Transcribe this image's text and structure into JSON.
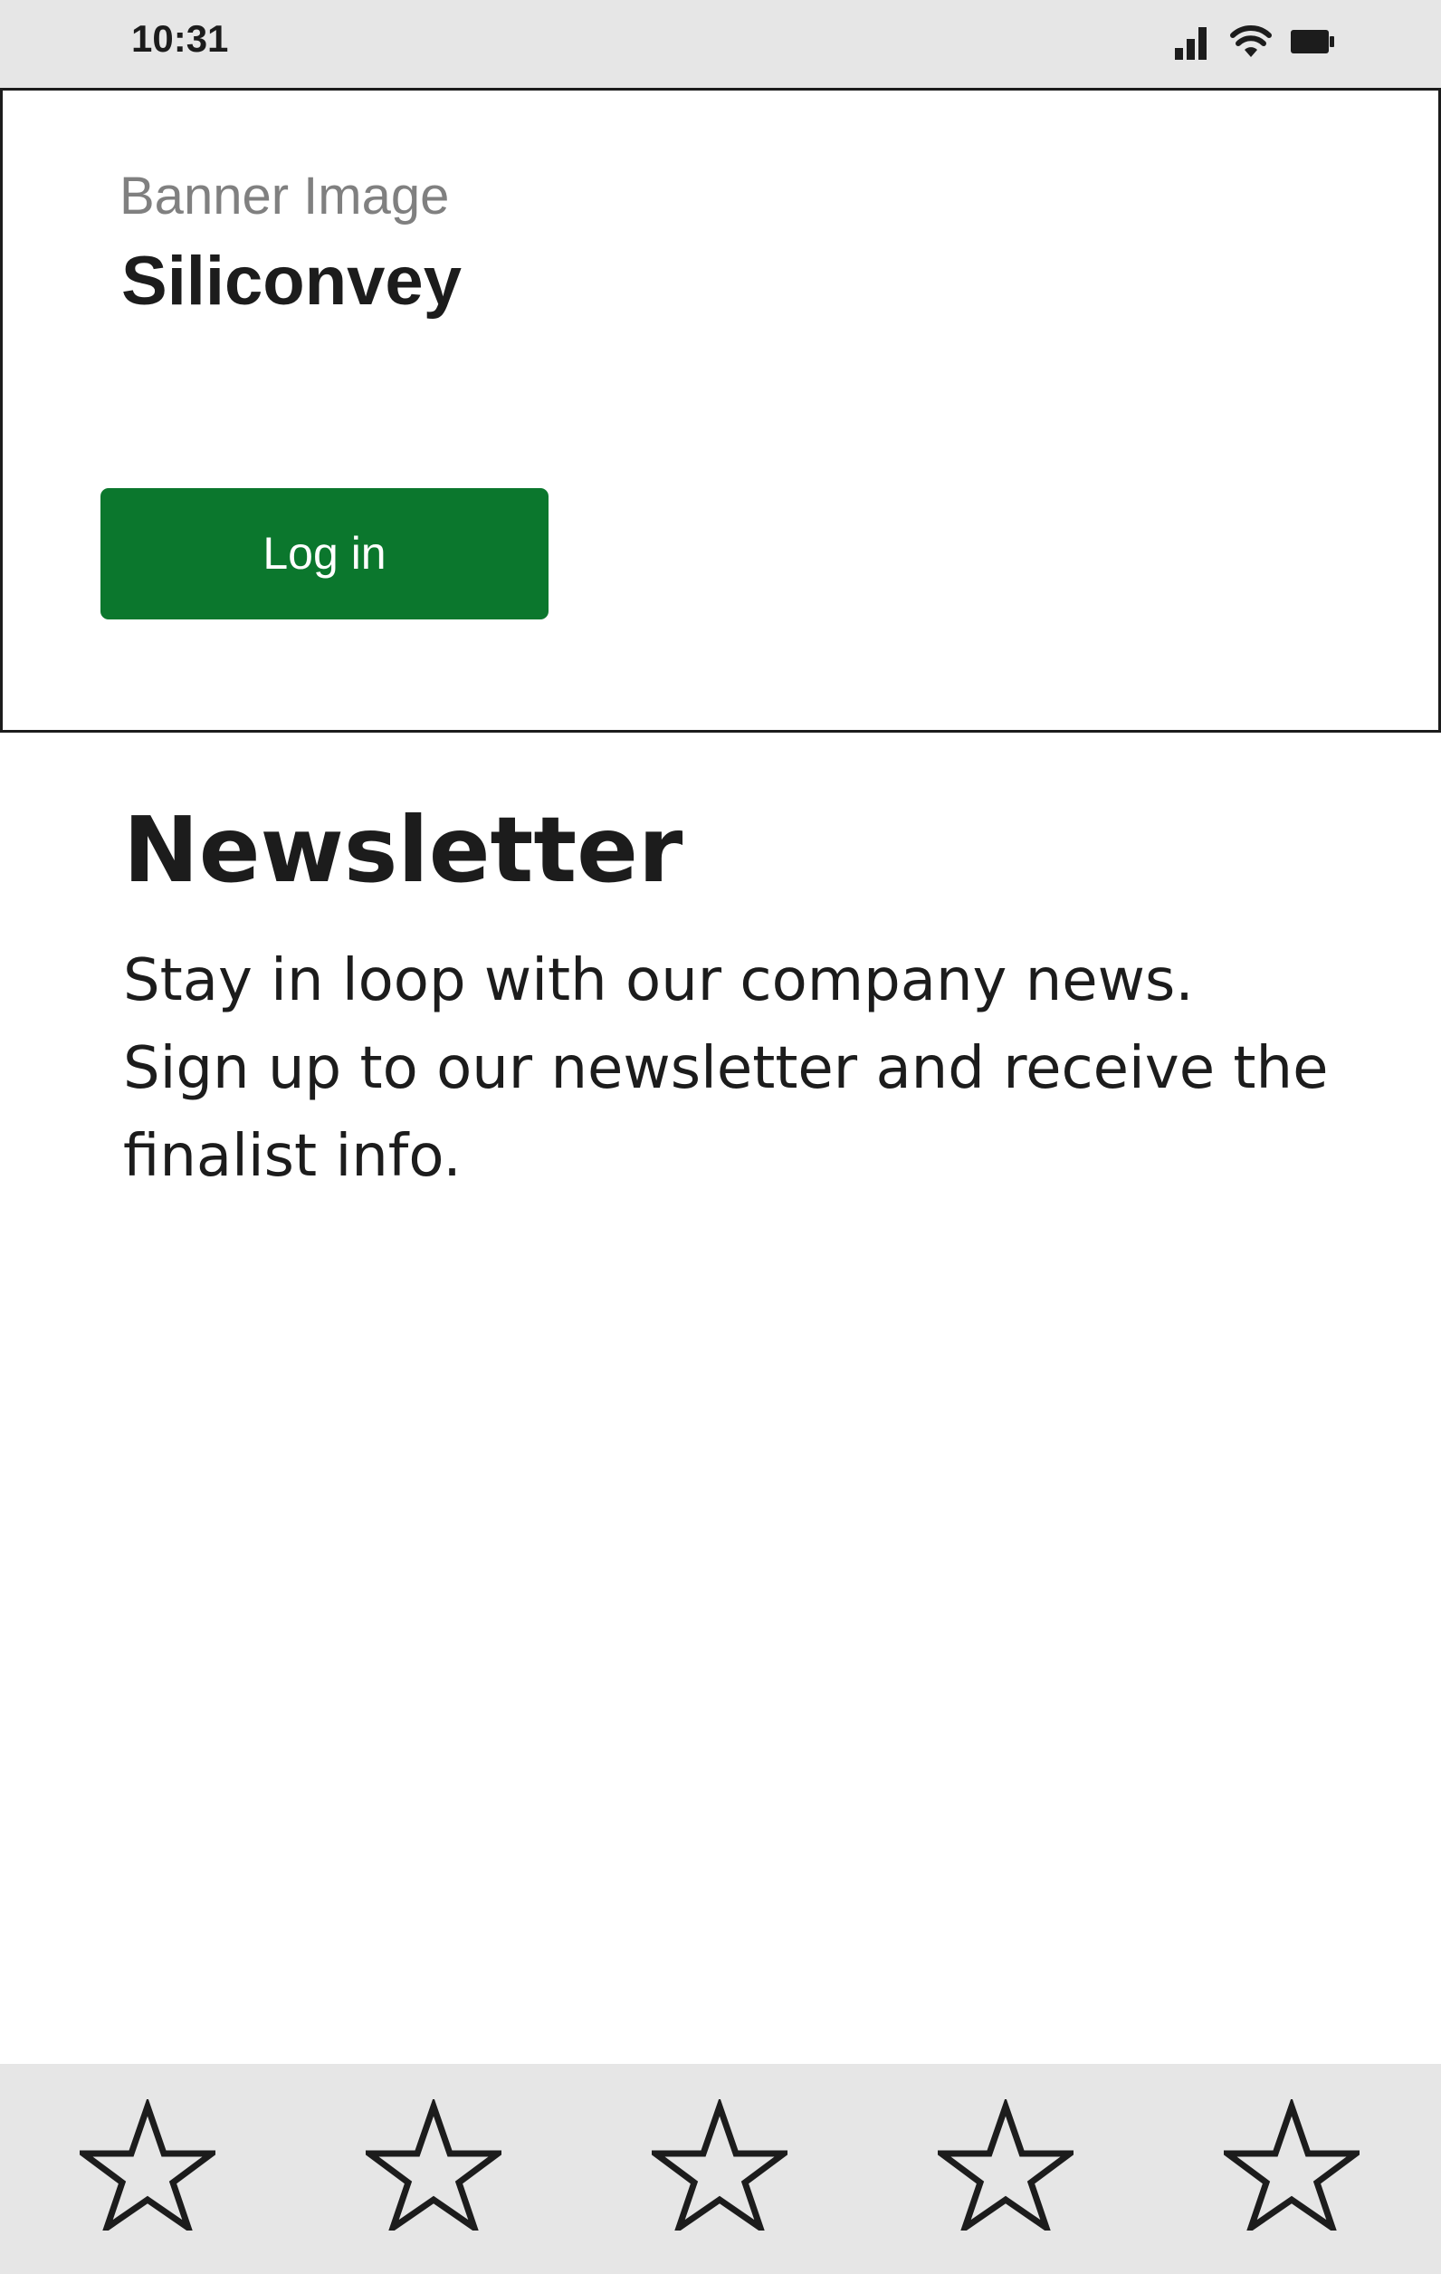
{
  "status_bar": {
    "time": "10:31",
    "icons": [
      "signal-icon",
      "wifi-icon",
      "battery-icon"
    ]
  },
  "banner": {
    "caption": "Banner Image",
    "title": "Siliconvey",
    "login_label": "Log in",
    "login_color": "#0b772d"
  },
  "newsletter": {
    "heading": "Newsletter",
    "lines": [
      "Stay in loop with our company news.",
      "Sign up to our newsletter and receive the",
      "finalist info."
    ]
  },
  "rating": {
    "max": 5,
    "value": 0
  }
}
